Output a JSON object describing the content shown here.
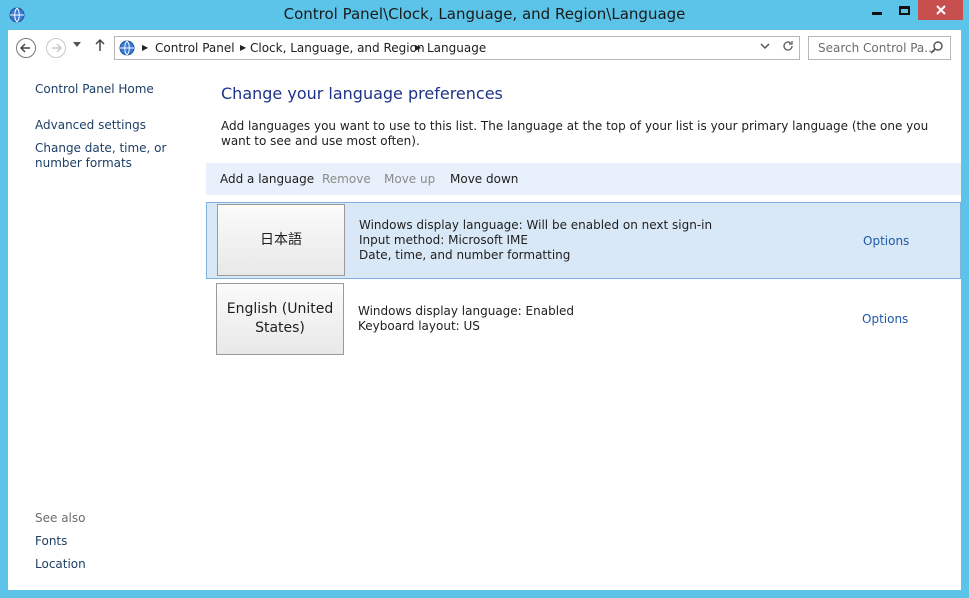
{
  "window": {
    "title": "Control Panel\\Clock, Language, and Region\\Language",
    "icon": "control-panel-globe-icon"
  },
  "navbar": {
    "breadcrumbs": [
      "Control Panel",
      "Clock, Language, and Region",
      "Language"
    ],
    "search_placeholder": "Search Control Pa..."
  },
  "sidebar": {
    "home": "Control Panel Home",
    "links": [
      "Advanced settings",
      "Change date, time, or number formats"
    ],
    "see_also_label": "See also",
    "see_also": [
      "Fonts",
      "Location"
    ]
  },
  "main": {
    "title": "Change your language preferences",
    "description": "Add languages you want to use to this list. The language at the top of your list is your primary language (the one you want to see and use most often).",
    "toolbar": {
      "add": "Add a language",
      "remove": "Remove",
      "move_up": "Move up",
      "move_down": "Move down"
    },
    "languages": [
      {
        "name": "日本語",
        "details": [
          "Windows display language: Will be enabled on next sign-in",
          "Input method: Microsoft IME",
          "Date, time, and number formatting"
        ],
        "options": "Options"
      },
      {
        "name": "English (United States)",
        "details": [
          "Windows display language: Enabled",
          "Keyboard layout: US"
        ],
        "options": "Options"
      }
    ]
  },
  "colors": {
    "accent_frame": "#5cc4e8",
    "close_button": "#c7504f",
    "title_blue": "#1e3287",
    "link_blue": "#1e5aa8",
    "toolbar_bg": "#e8f1fb",
    "selected_bg": "#d9e8f7"
  }
}
